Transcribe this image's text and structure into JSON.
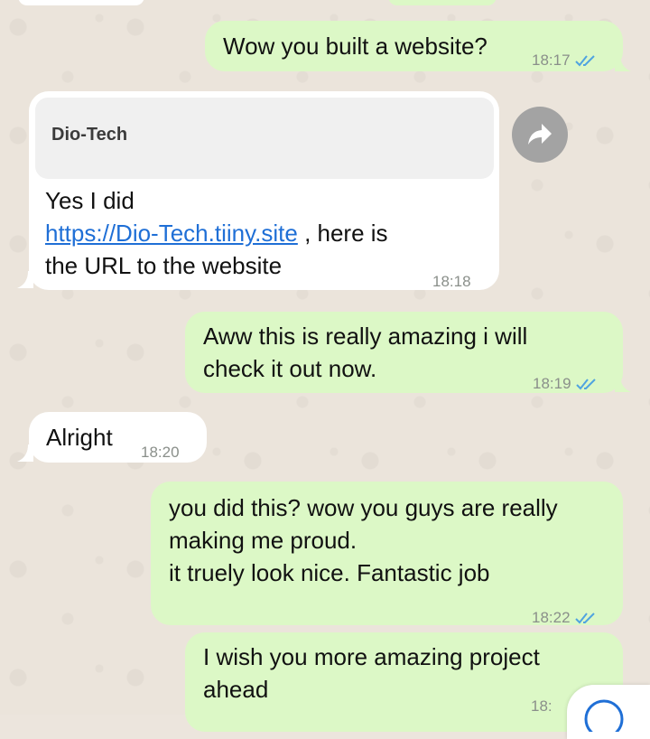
{
  "messages": [
    {
      "direction": "out",
      "text": "Wow you built a website?",
      "time": "18:17",
      "status": "read"
    },
    {
      "direction": "in",
      "quoted_author": "Dio-Tech",
      "text_before_link": "Yes I did",
      "link": "https://Dio-Tech.tiiny.site",
      "text_after_link": " , here is",
      "text_line3": "the URL to the website",
      "time": "18:18"
    },
    {
      "direction": "out",
      "text": "Aww this is really amazing i will\ncheck it out now.",
      "time": "18:19",
      "status": "read"
    },
    {
      "direction": "in",
      "text": "Alright",
      "time": "18:20"
    },
    {
      "direction": "out",
      "text": "you did this? wow you guys are really\nmaking me proud.\nit truely look nice. Fantastic job",
      "time": "18:22",
      "status": "read"
    },
    {
      "direction": "out",
      "text": "I wish you more amazing project\nahead",
      "time": "18:",
      "status": "read"
    }
  ],
  "icons": {
    "forward": "forward-arrow-icon",
    "read_ticks": "double-check-icon",
    "scroll_down": "chevron-down-icon"
  },
  "colors": {
    "outgoing_bubble": "#dcf8c6",
    "incoming_bubble": "#ffffff",
    "read_tick": "#4fa3e0",
    "link": "#1f6fd6",
    "wallpaper": "#ebe4db"
  }
}
